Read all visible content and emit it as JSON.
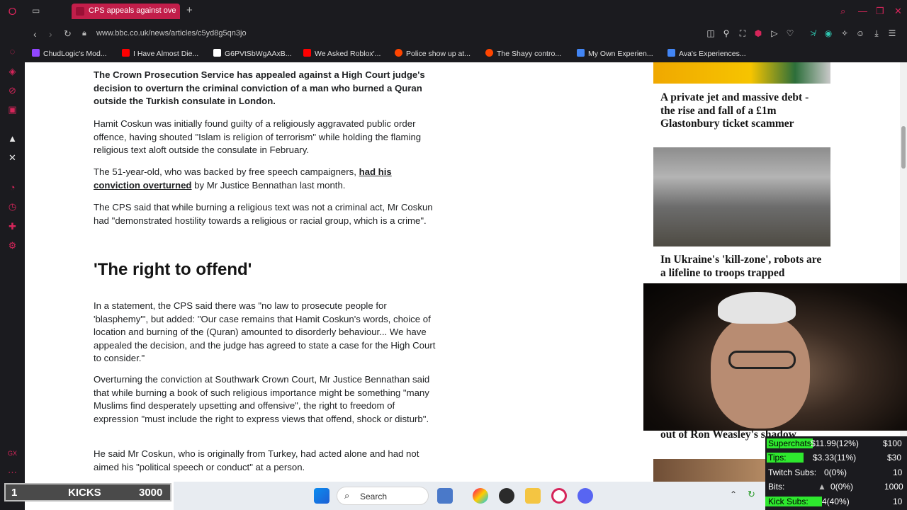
{
  "browser": {
    "tab_title": "CPS appeals against overt",
    "new_tab": "+",
    "url": "www.bbc.co.uk/news/articles/c5yd8g5qn3jo"
  },
  "bookmarks": [
    {
      "label": "ChudLogic's Mod...",
      "color": "#9146ff"
    },
    {
      "label": "I Have Almost Die...",
      "color": "#ff0000"
    },
    {
      "label": "G6PVtSbWgAAxB...",
      "color": "#ffffff"
    },
    {
      "label": "We Asked Roblox'...",
      "color": "#ff0000"
    },
    {
      "label": "Police show up at...",
      "color": "#ff4500"
    },
    {
      "label": "The Shayy contro...",
      "color": "#ff4500"
    },
    {
      "label": "My Own Experien...",
      "color": "#4285f4"
    },
    {
      "label": "Ava's Experiences...",
      "color": "#4285f4"
    }
  ],
  "article": {
    "lead": "The Crown Prosecution Service has appealed against a High Court judge's decision to overturn the criminal conviction of a man who burned a Quran outside the Turkish consulate in London.",
    "p1": "Hamit Coskun was initially found guilty of a religiously aggravated public order offence, having shouted \"Islam is religion of terrorism\" while holding the flaming religious text aloft outside the consulate in February.",
    "p2_before": "The 51-year-old, who was backed by free speech campaigners, ",
    "p2_link": "had his conviction overturned",
    "p2_after": " by Mr Justice Bennathan last month.",
    "p3": "The CPS said that while burning a religious text was not a criminal act, Mr Coskun had \"demonstrated hostility towards a religious or racial group, which is a crime\".",
    "heading": "'The right to offend'",
    "p4": "In a statement, the CPS said there was \"no law to prosecute people for 'blasphemy'\", but added: \"Our case remains that Hamit Coskun's words, choice of location and burning of the (Quran) amounted to disorderly behaviour... We have appealed the decision, and the judge has agreed to state a case for the High Court to consider.\"",
    "p5": "Overturning the conviction at Southwark Crown Court, Mr Justice Bennathan said that while burning a book of such religious importance might be something \"many Muslims find desperately upsetting and offensive\", the right to freedom of expression \"must include the right to express views that offend, shock or disturb\".",
    "p6": "He said Mr Coskun, who is originally from Turkey, had acted alone and had not aimed his \"political speech or conduct\" at a person."
  },
  "sidebar_stories": {
    "story1": "A private jet and massive debt - the rise and fall of a £1m Glastonbury ticket scammer",
    "story2": "In Ukraine's 'kill-zone', robots are a lifeline to troops trapped",
    "story3": "out of Ron Weasley's shadow"
  },
  "overlay": {
    "kicks_count": "1",
    "kicks_label": "KICKS",
    "kicks_goal": "3000",
    "stats": [
      {
        "label": "Superchats",
        "value": "$11.99(12%)",
        "goal": "$100",
        "highlight": true
      },
      {
        "label": "Tips:",
        "value": "$3.33(11%)",
        "goal": "$30",
        "highlight": true
      },
      {
        "label": "Twitch Subs:",
        "value": "0(0%)",
        "goal": "10",
        "highlight": false
      },
      {
        "label": "Bits:",
        "value": "0(0%)",
        "goal": "1000",
        "highlight": false
      },
      {
        "label": "Kick Subs:",
        "value": "4(40%)",
        "goal": "10",
        "highlight": true
      }
    ]
  },
  "taskbar": {
    "search_label": "Search"
  }
}
